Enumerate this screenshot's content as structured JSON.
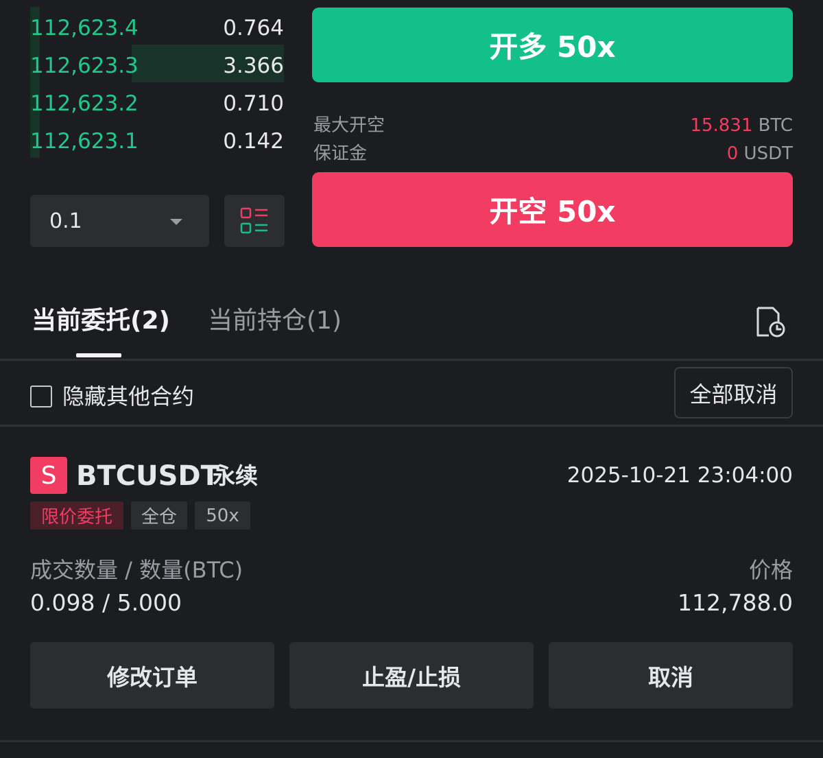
{
  "order_book": {
    "rows": [
      {
        "price": "112,623.4",
        "qty": "0.764",
        "depth": 0.0
      },
      {
        "price": "112,623.3",
        "qty": "3.366",
        "depth": 0.6
      },
      {
        "price": "112,623.2",
        "qty": "0.710",
        "depth": 0.0
      },
      {
        "price": "112,623.1",
        "qty": "0.142",
        "depth": 0.0
      }
    ],
    "step_value": "0.1"
  },
  "trade": {
    "long_label": "开多 50x",
    "short_label": "开空 50x",
    "max_short_label": "最大开空",
    "max_short_value": "15.831",
    "max_short_unit": " BTC",
    "margin_label": "保证金",
    "margin_value": "0",
    "margin_unit": " USDT"
  },
  "tabs": {
    "open_orders": "当前委托(2)",
    "positions": "当前持仓(1)"
  },
  "filters": {
    "hide_other_label": "隐藏其他合约",
    "cancel_all_label": "全部取消"
  },
  "order": {
    "side_badge": "S",
    "symbol": "BTCUSDT",
    "contract_type": "永续",
    "time": "2025-10-21 23:04:00",
    "tags": {
      "order_type": "限价委托",
      "margin_mode": "全仓",
      "leverage": "50x"
    },
    "filled_label": "成交数量 / 数量(BTC)",
    "filled_value": "0.098 / 5.000",
    "price_label": "价格",
    "price_value": "112,788.0",
    "actions": {
      "modify": "修改订单",
      "tpsl": "止盈/止损",
      "cancel": "取消"
    }
  },
  "colors": {
    "buy": "#14c08a",
    "sell": "#f23c62",
    "background": "#1c1d20"
  }
}
